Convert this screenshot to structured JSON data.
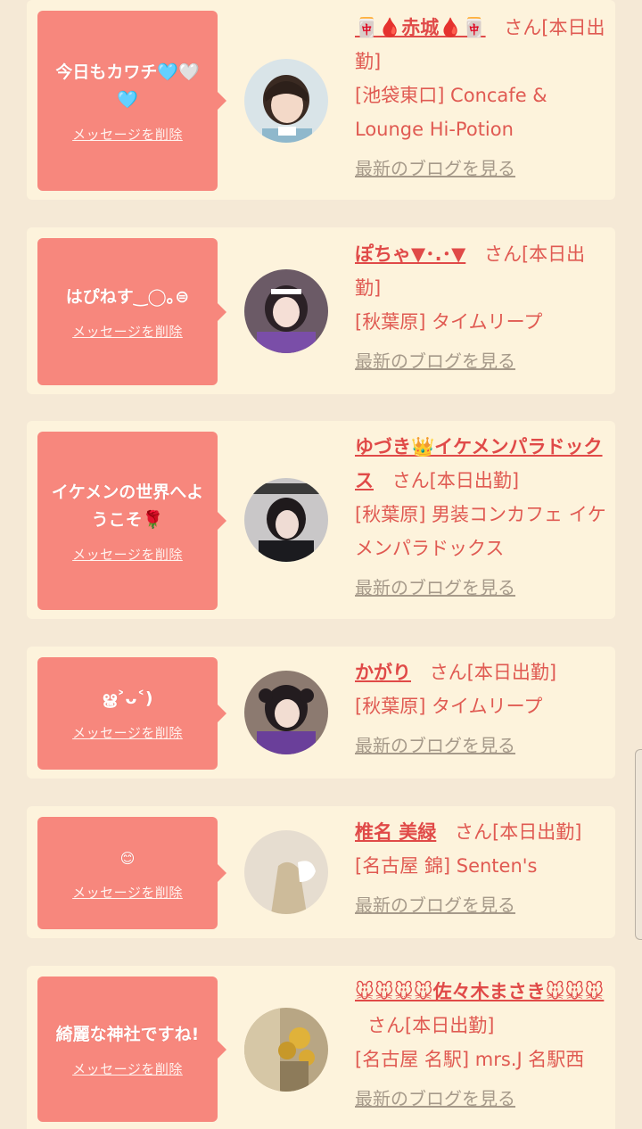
{
  "cards": [
    {
      "message": "今日もカワチ🩵🤍🩵",
      "delete_label": "メッセージを削除",
      "name": "🀄🩸赤城🩸🀄",
      "suffix": "さん[本日出勤]",
      "shop": "[池袋東口] Concafe & Lounge Hi-Potion",
      "blog_label": "最新のブログを見る"
    },
    {
      "message": "はぴねす‿◯｡⊜",
      "delete_label": "メッセージを削除",
      "name": "ぽちゃ▼･.･▼",
      "suffix": "さん[本日出勤]",
      "shop": "[秋葉原] タイムリープ",
      "blog_label": "最新のブログを見る"
    },
    {
      "message": "イケメンの世界へようこそ🌹",
      "delete_label": "メッセージを削除",
      "name": "ゆづき👑イケメンパラドックス",
      "suffix": "さん[本日出勤]",
      "shop": "[秋葉原] 男装コンカフェ イケメンパラドックス",
      "blog_label": "最新のブログを見る"
    },
    {
      "message": "ൠ˃ᴗ˂)",
      "delete_label": "メッセージを削除",
      "name": "かがり",
      "suffix": "さん[本日出勤]",
      "shop": "[秋葉原] タイムリープ",
      "blog_label": "最新のブログを見る"
    },
    {
      "message": "😊",
      "delete_label": "メッセージを削除",
      "name": "椎名 美緑",
      "suffix": "さん[本日出勤]",
      "shop": "[名古屋 錦] Senten's",
      "blog_label": "最新のブログを見る"
    },
    {
      "message": "綺麗な神社ですね!",
      "delete_label": "メッセージを削除",
      "name": "🐭🐭🐭🐭佐々木まさき🐭🐭🐭",
      "suffix": "さん[本日出勤]",
      "shop": "[名古屋 名駅] mrs.J 名駅西",
      "blog_label": "最新のブログを見る"
    }
  ],
  "colors": {
    "background": "#f5e9d6",
    "card": "#fdf3dc",
    "bubble": "#f7877d",
    "accent": "#e04a48",
    "link_muted": "#a69a8a"
  }
}
